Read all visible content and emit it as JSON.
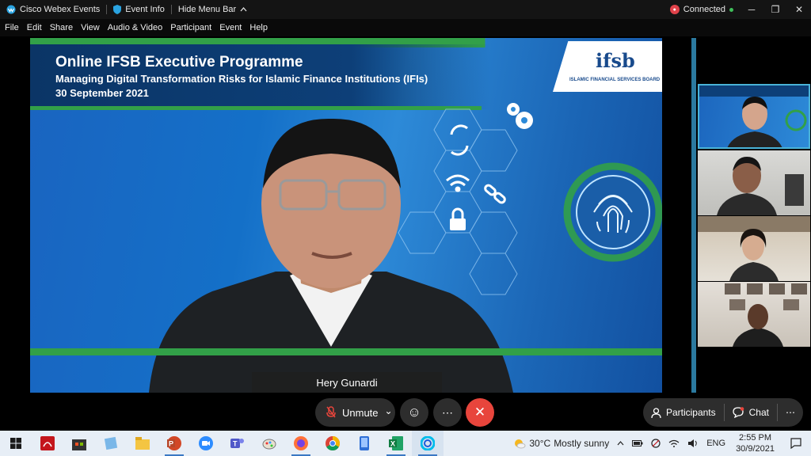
{
  "titlebar": {
    "app_name": "Cisco Webex Events",
    "event_info": "Event Info",
    "hide_menu": "Hide Menu Bar",
    "status": "Connected",
    "minimize": "─",
    "restore": "❐",
    "close": "✕"
  },
  "menubar": {
    "items": [
      "File",
      "Edit",
      "Share",
      "View",
      "Audio & Video",
      "Participant",
      "Event",
      "Help"
    ]
  },
  "slide": {
    "title": "Online IFSB Executive Programme",
    "subtitle": "Managing Digital Transformation Risks for Islamic Finance Institutions (IFIs)",
    "date": "30 September 2021",
    "logo_mark": "ifsb",
    "logo_text": "ISLAMIC FINANCIAL SERVICES BOARD"
  },
  "speaker": {
    "name": "Hery Gunardi"
  },
  "controls": {
    "unmute_label": "Unmute",
    "unmute_chevron": "⌄",
    "reactions_icon": "☺",
    "more_icon": "⋯",
    "end_icon": "✕",
    "participants_label": "Participants",
    "chat_label": "Chat",
    "more_right_icon": "⋯"
  },
  "taskbar": {
    "weather_temp": "30°C",
    "weather_text": "Mostly sunny",
    "language": "ENG",
    "time": "2:55 PM",
    "date": "30/9/2021"
  },
  "colors": {
    "accent_green": "#32a048",
    "slide_blue": "#1a64c0",
    "end_red": "#e8453c",
    "connected_red": "#e0424a"
  }
}
